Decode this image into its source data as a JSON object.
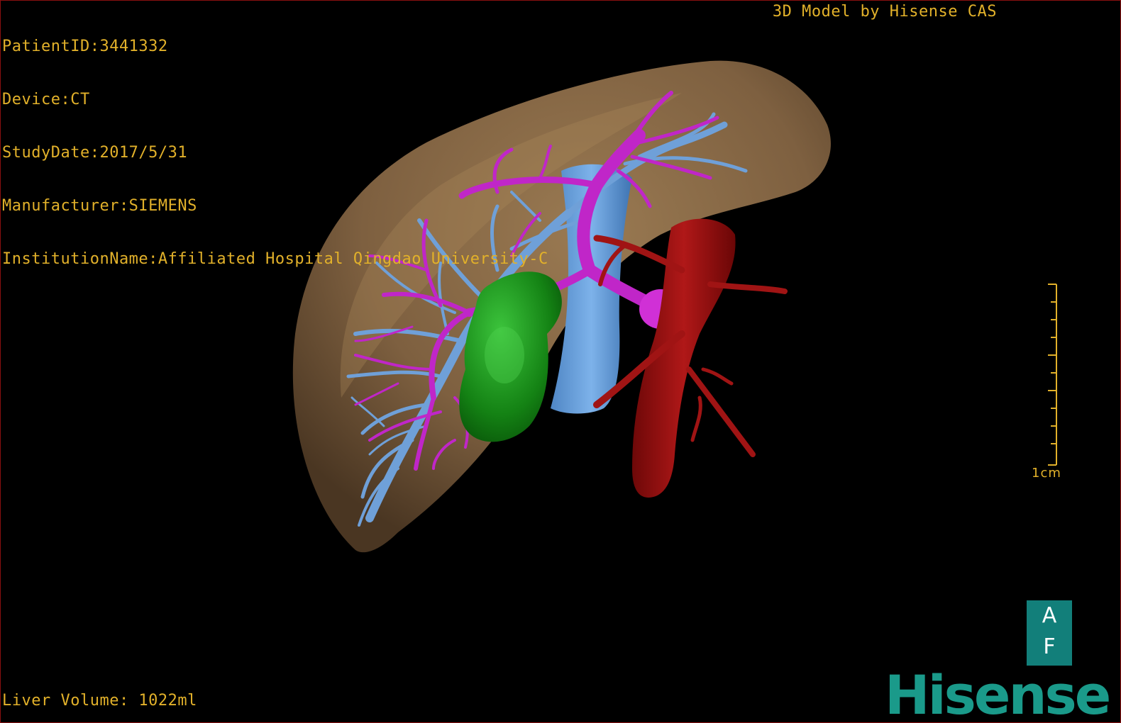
{
  "study": {
    "patient_id": "PatientID:3441332",
    "device": "Device:CT",
    "study_date": "StudyDate:2017/5/31",
    "manufacturer": "Manufacturer:SIEMENS",
    "institution": "InstitutionName:Affiliated Hospital Qingdao University-C"
  },
  "credit": "3D Model by Hisense CAS",
  "volume": "Liver Volume: 1022ml",
  "scale_bar": {
    "label": "1cm"
  },
  "orientation": {
    "top": "A",
    "bottom": "F"
  },
  "brand": "Hisense",
  "colors": {
    "overlay_text": "#e2b12a",
    "liver": "#8b6a45",
    "portal_vein": "#c026c8",
    "hepatic_vein": "#6fa0d8",
    "tumor": "#1e8c1e",
    "artery": "#9a1212",
    "brand": "#1a9a8a",
    "border": "#8a1010"
  }
}
